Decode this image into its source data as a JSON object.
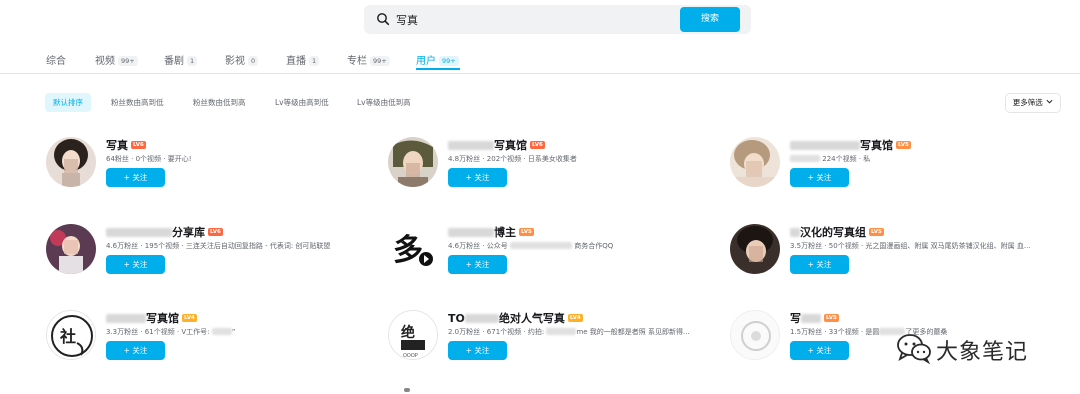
{
  "search": {
    "query": "写真",
    "button_label": "搜索"
  },
  "tabs": [
    {
      "label": "综合",
      "count": ""
    },
    {
      "label": "视频",
      "count": "99+"
    },
    {
      "label": "番剧",
      "count": "1"
    },
    {
      "label": "影视",
      "count": "0"
    },
    {
      "label": "直播",
      "count": "1"
    },
    {
      "label": "专栏",
      "count": "99+"
    },
    {
      "label": "用户",
      "count": "99+"
    }
  ],
  "active_tab": "用户",
  "sort_options": [
    "默认排序",
    "粉丝数由高到低",
    "粉丝数由低到高",
    "Lv等级由高到低",
    "Lv等级由低到高"
  ],
  "more_filters_label": "更多筛选",
  "follow_label": "+ 关注",
  "users": [
    {
      "name": "写真",
      "level": "LV6",
      "meta": "64粉丝 · 0个视频 · 要开心!",
      "avatar": "photo-girl"
    },
    {
      "name_suffix": "写真馆",
      "level": "LV6",
      "meta_a": "4.8万粉丝 · 202个视频 · 日系美女收集者",
      "avatar": "photo-girl"
    },
    {
      "name_suffix": "写真馆",
      "level": "LV5",
      "meta_b": "224个视频 · 私",
      "avatar": "photo-girl"
    },
    {
      "name_suffix": "分享库",
      "level": "LV6",
      "meta": "4.6万粉丝 · 195个视频 · 三连关注后自动回复指路 - 代表词: 创可贴联盟",
      "avatar": "photo-girl"
    },
    {
      "name_suffix": "博主",
      "level": "LV5",
      "meta_a": "4.6万粉丝 · 公众号",
      "meta_b": "商务合作QQ",
      "avatar": "logo-duo"
    },
    {
      "name_suffix": "汉化的写真组",
      "level": "LV5",
      "meta_a": "3.5万粉丝 · 50个视频 · 光之国漫画组、附属 双马尾奶茶铺汉化组、附属 血...",
      "avatar": "photo-girl"
    },
    {
      "name_suffix": "写真馆",
      "level": "LV4",
      "meta_a": "3.3万粉丝 · 61个视频 · V工作号: ",
      "meta_b": "”",
      "avatar": "logo-circle"
    },
    {
      "name_prefix": "TO",
      "name_suffix": "绝对人气写真",
      "level": "LV4",
      "meta_a": "2.0万粉丝 · 671个视频 · 约拍: ",
      "meta_b": "me 我的一般都是者照 系见即新得...",
      "avatar": "logo-text"
    },
    {
      "name_suffix": "写",
      "level": "LV5",
      "meta_a": "1.5万粉丝 · 33个视频 · 是圆",
      "meta_b": "了更多的蘑桑",
      "avatar": "logo-faint"
    }
  ],
  "watermark": {
    "text": "大象笔记",
    "icon": "wechat-icon"
  },
  "colors": {
    "accent": "#00aeec",
    "lv6": "#ff6740",
    "lv5": "#ff8f45",
    "lv4": "#ffb027"
  }
}
